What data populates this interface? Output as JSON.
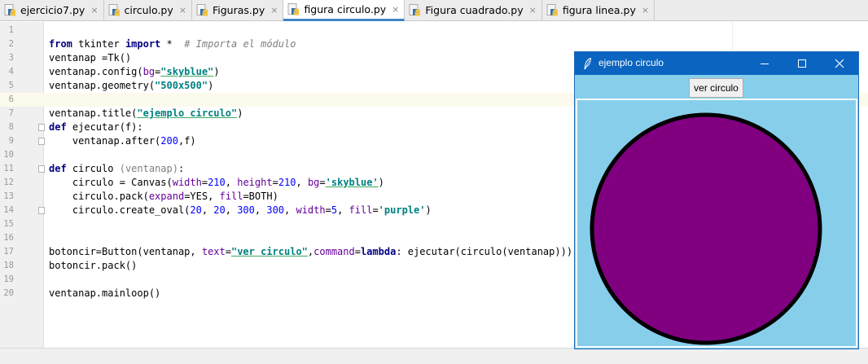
{
  "tabs": [
    {
      "label": "ejercicio7.py",
      "active": false
    },
    {
      "label": "circulo.py",
      "active": false
    },
    {
      "label": "Figuras.py",
      "active": false
    },
    {
      "label": "figura circulo.py",
      "active": true
    },
    {
      "label": "Figura cuadrado.py",
      "active": false
    },
    {
      "label": "figura linea.py",
      "active": false
    }
  ],
  "tab_close_glyph": "×",
  "editor": {
    "line_numbers": [
      "1",
      "2",
      "3",
      "4",
      "5",
      "6",
      "7",
      "8",
      "9",
      "10",
      "11",
      "12",
      "13",
      "14",
      "15",
      "16",
      "17",
      "18",
      "19",
      "20"
    ],
    "lines": {
      "l2": {
        "kw_from": "from",
        "mod": " tkinter ",
        "kw_import": "import",
        "star": " *  ",
        "comment": "# Importa el módulo"
      },
      "l3": {
        "text": "ventanap =Tk()"
      },
      "l4": {
        "a": "ventanap.config(",
        "param": "bg",
        "eq": "=",
        "str": "\"skyblue\"",
        "b": ")"
      },
      "l5": {
        "a": "ventanap.geometry(",
        "str": "\"500x500\"",
        "b": ")"
      },
      "l7": {
        "a": "ventanap.title(",
        "str": "\"ejemplo circulo\"",
        "b": ")"
      },
      "l8": {
        "kw": "def",
        "a": " ejecutar(f):"
      },
      "l9": {
        "a": "    ventanap.after(",
        "num": "200",
        "b": ",f)"
      },
      "l11": {
        "kw": "def",
        "a": " circulo ",
        "faint": "(ventanap)",
        "b": ":"
      },
      "l12": {
        "a": "    circulo = Canvas(",
        "p1": "width",
        "e1": "=",
        "n1": "210",
        "c1": ", ",
        "p2": "height",
        "e2": "=",
        "n2": "210",
        "c2": ", ",
        "p3": "bg",
        "e3": "=",
        "s1": "'skyblue'",
        "b": ")"
      },
      "l13": {
        "a": "    circulo.pack(",
        "p1": "expand",
        "e1": "=YES, ",
        "p2": "fill",
        "e2": "=BOTH)"
      },
      "l14": {
        "a": "    circulo.create_oval(",
        "n1": "20",
        "c1": ", ",
        "n2": "20",
        "c2": ", ",
        "n3": "300",
        "c3": ", ",
        "n4": "300",
        "c4": ", ",
        "p1": "width",
        "e1": "=",
        "n5": "5",
        "c5": ", ",
        "p2": "fill",
        "e2": "=",
        "s1": "'purple'",
        "b": ")"
      },
      "l17": {
        "a": "botoncir=Button(ventanap, ",
        "p1": "text",
        "e1": "=",
        "s1": "\"ver circulo\"",
        "c1": ",",
        "p2": "command",
        "e2": "=",
        "kw": "lambda",
        "b": ": ejecutar(circulo(ventanap)))"
      },
      "l18": {
        "text": "botoncir.pack()"
      },
      "l20": {
        "text": "ventanap.mainloop()"
      }
    }
  },
  "tkwindow": {
    "title": "ejemplo circulo",
    "button_label": "ver circulo",
    "bg_color": "#87ceeb",
    "circle_fill": "#800080",
    "circle_outline": "#000000",
    "titlebar_color": "#0a64c0",
    "window_controls": [
      "minimize-icon",
      "maximize-icon",
      "close-icon"
    ]
  }
}
